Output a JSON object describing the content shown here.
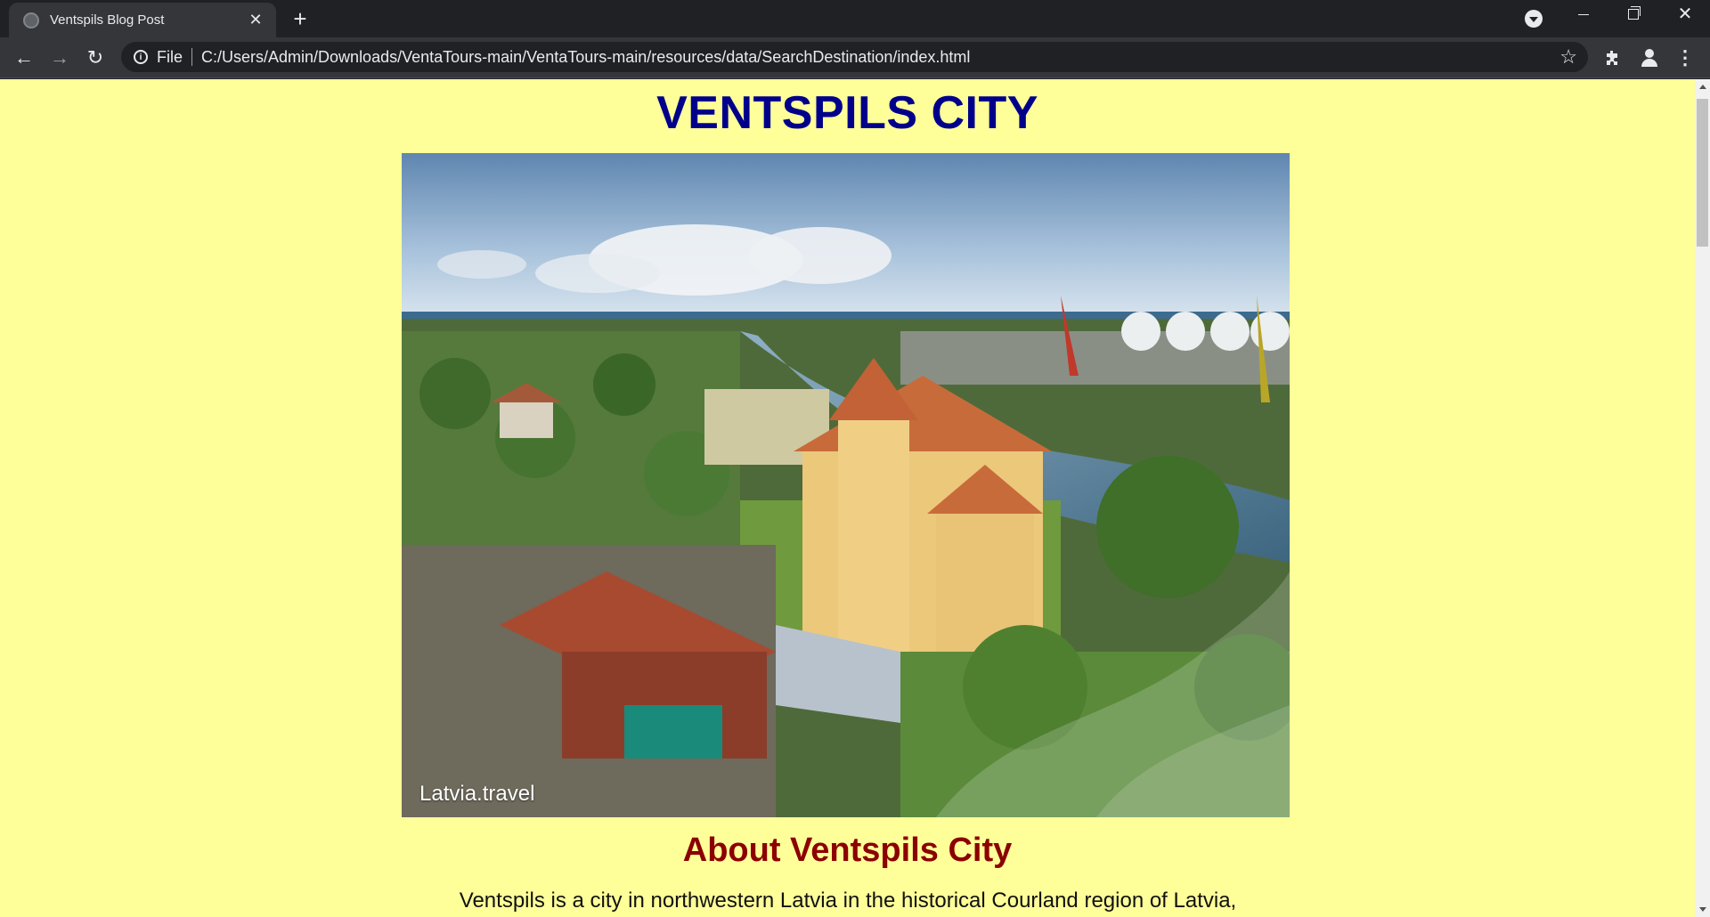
{
  "browser": {
    "tab_title": "Ventspils Blog Post",
    "scheme": "File",
    "url": "C:/Users/Admin/Downloads/VentaTours-main/VentaTours-main/resources/data/SearchDestination/index.html"
  },
  "page": {
    "title": "VENTSPILS CITY",
    "hero_credit": "Latvia.travel",
    "section_title": "About Ventspils City",
    "intro_text": "Ventspils is a city in northwestern Latvia in the historical Courland region of Latvia,"
  },
  "colors": {
    "page_background": "#ffff99",
    "title_color": "#00008b",
    "section_title_color": "#8b0000"
  }
}
